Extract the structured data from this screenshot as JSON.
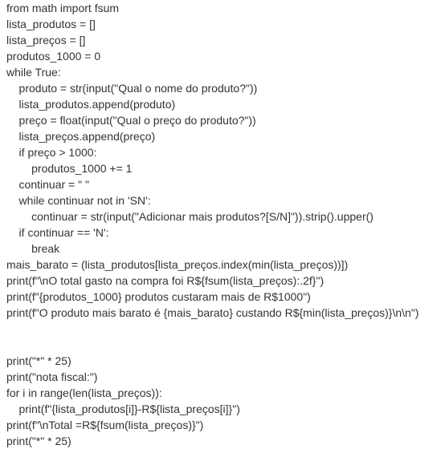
{
  "code_lines": [
    "from math import fsum",
    "lista_produtos = []",
    "lista_preços = []",
    "produtos_1000 = 0",
    "while True:",
    "    produto = str(input(\"Qual o nome do produto?\"))",
    "    lista_produtos.append(produto)",
    "    preço = float(input(\"Qual o preço do produto?\"))",
    "    lista_preços.append(preço)",
    "    if preço > 1000:",
    "        produtos_1000 += 1",
    "    continuar = \" \"",
    "    while continuar not in 'SN':",
    "        continuar = str(input(\"Adicionar mais produtos?[S/N]\")).strip().upper()",
    "    if continuar == 'N':",
    "        break",
    "mais_barato = (lista_produtos[lista_preços.index(min(lista_preços))])",
    "print(f\"\\nO total gasto na compra foi R${fsum(lista_preços):.2f}\")",
    "print(f\"{produtos_1000} produtos custaram mais de R$1000\")",
    "print(f\"O produto mais barato é {mais_barato} custando R${min(lista_preços)}\\n\\n\")",
    "",
    "",
    "print(\"*\" * 25)",
    "print(\"nota fiscal:\")",
    "for i in range(len(lista_preços)):",
    "    print(f\"{lista_produtos[i]}-R${lista_preços[i]}\")",
    "print(f\"\\nTotal =R${fsum(lista_preços)}\")",
    "print(\"*\" * 25)"
  ]
}
